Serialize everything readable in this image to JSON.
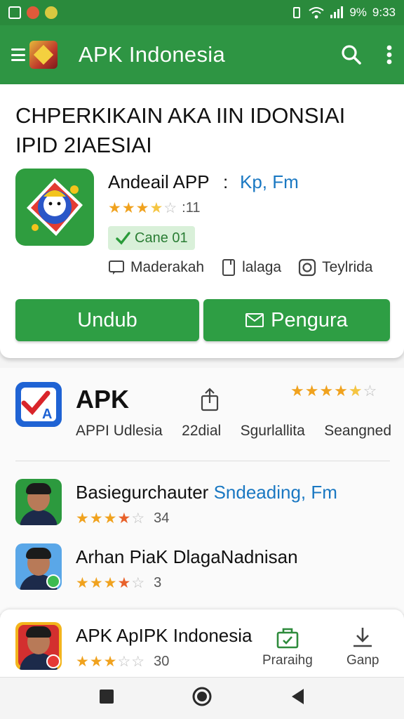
{
  "status": {
    "battery": "9%",
    "time": "9:33"
  },
  "appbar": {
    "title": "APK Indonesia"
  },
  "featured": {
    "headline_line1": "CHPERKIKAIN AKA IIN IDONSIAI",
    "headline_line2": "IPID 2IAESIAI",
    "app_name": "Andeail APP",
    "separator": ":",
    "link": "Kp, Fm",
    "rating_stars": "3.5/5",
    "rating_count": ":11",
    "badge": "Cane 01",
    "meta": [
      "Maderakah",
      "lalaga",
      "Teylrida"
    ],
    "download_label": "Undub",
    "manage_label": "Pengura"
  },
  "apk_block": {
    "title": "APK",
    "rating_stars": "4.5/5",
    "stats": [
      "APPI Udlesia",
      "22dial",
      "Sgurlallita",
      "Seangned"
    ]
  },
  "list": [
    {
      "name": "Basiegurchauter",
      "link": "Sndeading, Fm",
      "rating_count": "34",
      "rating_stars": "3.5/5"
    },
    {
      "name": "Arhan PiaK DlagaNadnisan",
      "link": "",
      "rating_count": "3",
      "rating_stars": "3.5/5"
    }
  ],
  "bottom_card": {
    "name": "APK ApIPK Indonesia",
    "rating_count": "30",
    "rating_stars": "3/5",
    "action1_label": "Praraihg",
    "action2_label": "Ganp"
  },
  "colors": {
    "primary": "#2e9543",
    "accent_star": "#f0a21e",
    "link": "#1a78c2"
  },
  "icons": [
    "menu-icon",
    "search-icon",
    "more-vert-icon",
    "chat-icon",
    "tablet-icon",
    "camera-icon",
    "mail-icon",
    "share-icon",
    "bag-icon",
    "download-icon",
    "nav-square-icon",
    "nav-home-icon",
    "nav-back-icon"
  ]
}
